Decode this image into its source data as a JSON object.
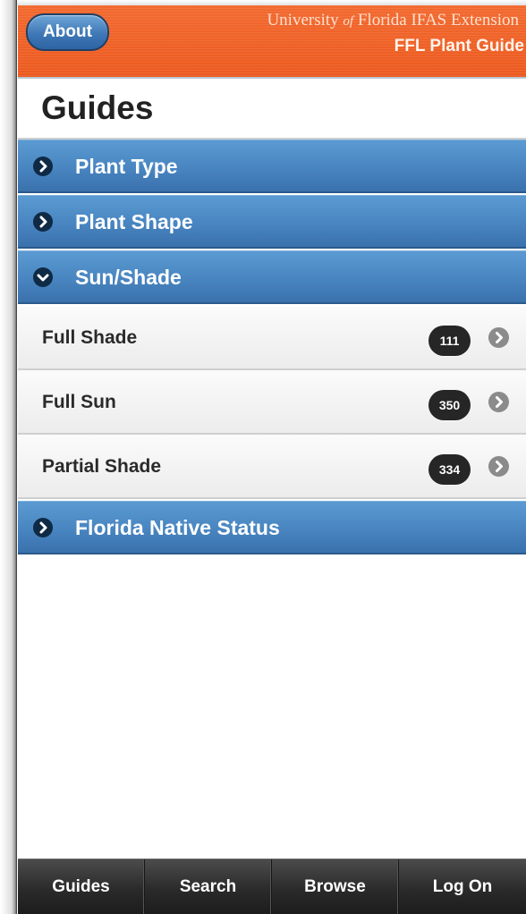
{
  "header": {
    "about_label": "About",
    "org_part1": "University",
    "org_of": "of",
    "org_part2": "Florida  IFAS Extension",
    "app_name": "FFL Plant Guide"
  },
  "page_title": "Guides",
  "sections": [
    {
      "label": "Plant Type",
      "expanded": false
    },
    {
      "label": "Plant Shape",
      "expanded": false
    },
    {
      "label": "Sun/Shade",
      "expanded": true
    },
    {
      "label": "Florida Native Status",
      "expanded": false
    }
  ],
  "sun_shade_items": [
    {
      "label": "Full Shade",
      "count": "111"
    },
    {
      "label": "Full Sun",
      "count": "350"
    },
    {
      "label": "Partial Shade",
      "count": "334"
    }
  ],
  "tabs": [
    {
      "label": "Guides"
    },
    {
      "label": "Search"
    },
    {
      "label": "Browse"
    },
    {
      "label": "Log On"
    }
  ],
  "colors": {
    "header_orange": "#ec5a1f",
    "section_blue": "#4a87c2",
    "about_blue": "#3f78b6",
    "count_badge": "#262626",
    "tabbar": "#2a2a2a"
  },
  "icons": {
    "collapsed": "chevron-right-icon",
    "expanded": "chevron-down-icon",
    "item_arrow": "arrow-right-icon"
  }
}
